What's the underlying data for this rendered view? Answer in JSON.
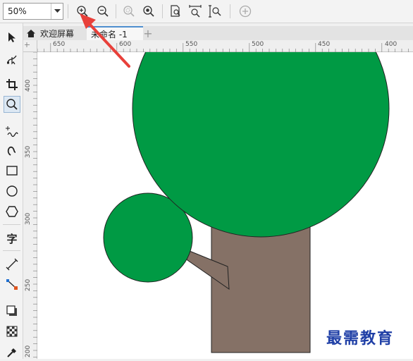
{
  "toolbar": {
    "zoom_value": "50%",
    "buttons": [
      {
        "name": "zoom-in"
      },
      {
        "name": "zoom-out"
      },
      {
        "name": "zoom-selected"
      },
      {
        "name": "zoom-all-objects"
      },
      {
        "name": "zoom-page"
      },
      {
        "name": "zoom-page-width"
      },
      {
        "name": "zoom-page-height"
      },
      {
        "name": "add"
      }
    ]
  },
  "tabs": {
    "welcome_label": "欢迎屏幕",
    "document_label": "未命名 -1",
    "add_label": "+"
  },
  "rulers": {
    "horizontal_labels": [
      "650",
      "600",
      "550",
      "500",
      "450",
      "400"
    ],
    "vertical_labels": [
      "400",
      "350",
      "300",
      "250",
      "200"
    ]
  },
  "toolbox": {
    "text_tool_label": "字"
  },
  "canvas": {
    "shapes": [
      "tree-crown",
      "small-crown",
      "branch",
      "tree-trunk"
    ],
    "colors": {
      "crown": "#009a44",
      "trunk": "#857166",
      "outline": "#222222",
      "annotation_arrow": "#e8403a"
    }
  },
  "watermark": "最需教育"
}
